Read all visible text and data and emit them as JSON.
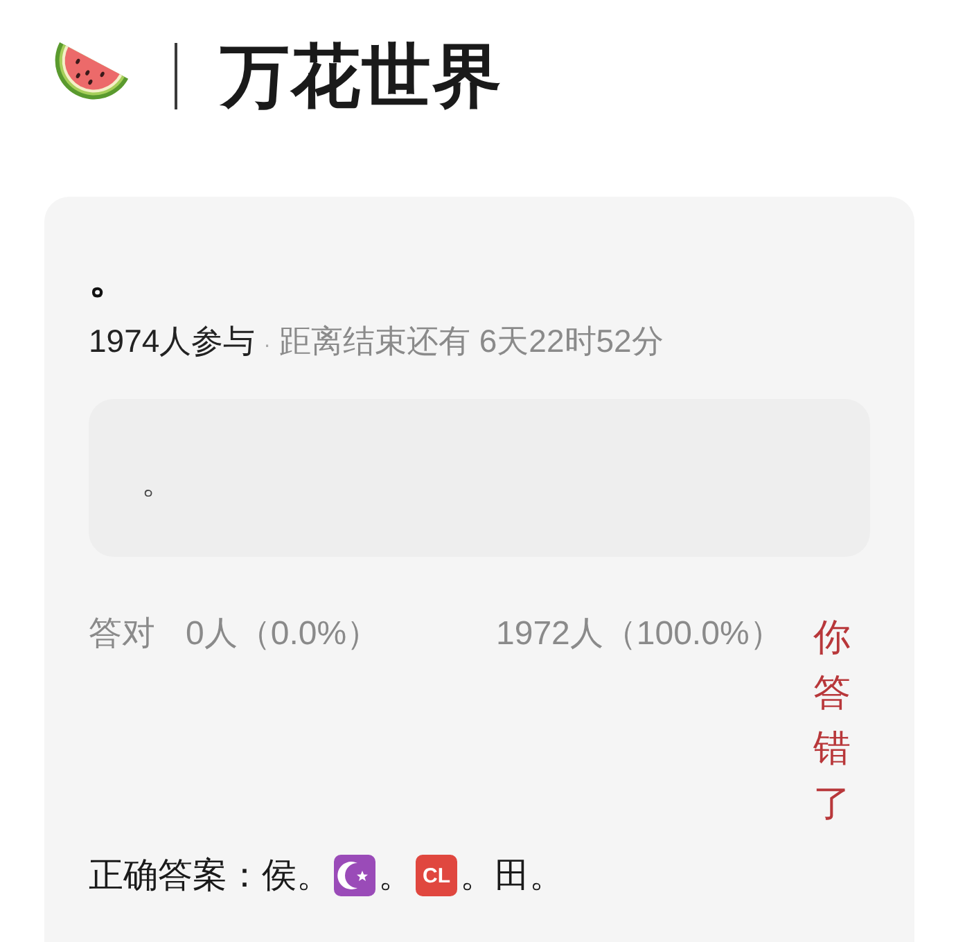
{
  "header": {
    "title": "万花世界"
  },
  "poll": {
    "title": "。",
    "participants": "1974人参与",
    "separator": "·",
    "countdown": "距离结束还有 6天22时52分",
    "question": {
      "text": "。"
    },
    "stats": {
      "correct_label": "答对",
      "correct_count": "0人（0.0%）",
      "wrong_count": "1972人（100.0%）"
    },
    "result": {
      "text": "你答错了",
      "correct": false
    },
    "correct_answer": {
      "label": "正确答案：",
      "parts": [
        {
          "kind": "text",
          "text": "侯。"
        },
        {
          "kind": "crescent"
        },
        {
          "kind": "text",
          "text": "。"
        },
        {
          "kind": "tile",
          "text": "CL"
        },
        {
          "kind": "text",
          "text": "。田。"
        }
      ]
    }
  }
}
